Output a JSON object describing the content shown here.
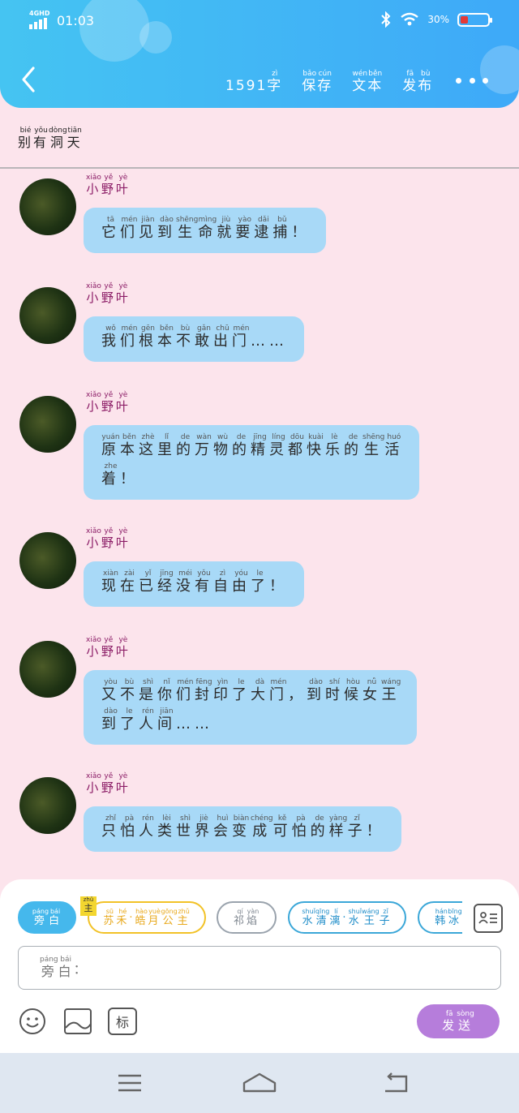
{
  "status_bar": {
    "network": "4GHD",
    "time": "01:03",
    "battery": "30%"
  },
  "header": {
    "word_count": "1591",
    "actions": [
      {
        "name": "word-count-unit",
        "text": "字",
        "pinyin": "zì"
      },
      {
        "name": "save-button",
        "chars": [
          {
            "c": "保",
            "p": "bǎo"
          },
          {
            "c": "存",
            "p": "cún"
          }
        ]
      },
      {
        "name": "text-button",
        "chars": [
          {
            "c": "文",
            "p": "wén"
          },
          {
            "c": "本",
            "p": "běn"
          }
        ]
      },
      {
        "name": "publish-button",
        "chars": [
          {
            "c": "发",
            "p": "fā"
          },
          {
            "c": "布",
            "p": "bù"
          }
        ]
      }
    ]
  },
  "document_title": [
    {
      "c": "别",
      "p": "bié"
    },
    {
      "c": "有",
      "p": "yǒu"
    },
    {
      "c": "洞",
      "p": "dòng"
    },
    {
      "c": "天",
      "p": "tiān"
    }
  ],
  "speaker_name": [
    {
      "c": "小",
      "p": "xiǎo"
    },
    {
      "c": "野",
      "p": "yě"
    },
    {
      "c": "叶",
      "p": "yè"
    }
  ],
  "messages": [
    {
      "lines": [
        [
          {
            "c": "它",
            "p": "tā"
          },
          {
            "c": "们",
            "p": "mén"
          },
          {
            "c": "见",
            "p": "jiàn"
          },
          {
            "c": "到",
            "p": "dào"
          },
          {
            "c": "生",
            "p": "shēng"
          },
          {
            "c": "命",
            "p": "mìng"
          },
          {
            "c": "就",
            "p": "jiù"
          },
          {
            "c": "要",
            "p": "yào"
          },
          {
            "c": "逮",
            "p": "dǎi"
          },
          {
            "c": "捕",
            "p": "bǔ"
          },
          {
            "c": "！",
            "p": ""
          }
        ]
      ]
    },
    {
      "lines": [
        [
          {
            "c": "我",
            "p": "wǒ"
          },
          {
            "c": "们",
            "p": "mén"
          },
          {
            "c": "根",
            "p": "gēn"
          },
          {
            "c": "本",
            "p": "běn"
          },
          {
            "c": "不",
            "p": "bù"
          },
          {
            "c": "敢",
            "p": "gǎn"
          },
          {
            "c": "出",
            "p": "chū"
          },
          {
            "c": "门",
            "p": "mén"
          },
          {
            "c": "……",
            "p": ""
          }
        ]
      ]
    },
    {
      "lines": [
        [
          {
            "c": "原",
            "p": "yuán"
          },
          {
            "c": "本",
            "p": "běn"
          },
          {
            "c": "这",
            "p": "zhè"
          },
          {
            "c": "里",
            "p": "lǐ"
          },
          {
            "c": "的",
            "p": "de"
          },
          {
            "c": "万",
            "p": "wàn"
          },
          {
            "c": "物",
            "p": "wù"
          },
          {
            "c": "的",
            "p": "de"
          },
          {
            "c": "精",
            "p": "jīng"
          },
          {
            "c": "灵",
            "p": "líng"
          },
          {
            "c": "都",
            "p": "dōu"
          },
          {
            "c": "快",
            "p": "kuài"
          },
          {
            "c": "乐",
            "p": "lè"
          },
          {
            "c": "的",
            "p": "de"
          },
          {
            "c": "生",
            "p": "shēng"
          },
          {
            "c": "活",
            "p": "huó"
          }
        ],
        [
          {
            "c": "着",
            "p": "zhe"
          },
          {
            "c": "！",
            "p": ""
          }
        ]
      ]
    },
    {
      "lines": [
        [
          {
            "c": "现",
            "p": "xiàn"
          },
          {
            "c": "在",
            "p": "zài"
          },
          {
            "c": "已",
            "p": "yǐ"
          },
          {
            "c": "经",
            "p": "jīng"
          },
          {
            "c": "没",
            "p": "méi"
          },
          {
            "c": "有",
            "p": "yǒu"
          },
          {
            "c": "自",
            "p": "zì"
          },
          {
            "c": "由",
            "p": "yóu"
          },
          {
            "c": "了",
            "p": "le"
          },
          {
            "c": "！",
            "p": ""
          }
        ]
      ]
    },
    {
      "lines": [
        [
          {
            "c": "又",
            "p": "yòu"
          },
          {
            "c": "不",
            "p": "bù"
          },
          {
            "c": "是",
            "p": "shì"
          },
          {
            "c": "你",
            "p": "nǐ"
          },
          {
            "c": "们",
            "p": "mén"
          },
          {
            "c": "封",
            "p": "fēng"
          },
          {
            "c": "印",
            "p": "yìn"
          },
          {
            "c": "了",
            "p": "le"
          },
          {
            "c": "大",
            "p": "dà"
          },
          {
            "c": "门",
            "p": "mén"
          },
          {
            "c": "，",
            "p": ""
          },
          {
            "c": "到",
            "p": "dào"
          },
          {
            "c": "时",
            "p": "shí"
          },
          {
            "c": "候",
            "p": "hòu"
          },
          {
            "c": "女",
            "p": "nǚ"
          },
          {
            "c": "王",
            "p": "wáng"
          }
        ],
        [
          {
            "c": "到",
            "p": "dào"
          },
          {
            "c": "了",
            "p": "le"
          },
          {
            "c": "人",
            "p": "rén"
          },
          {
            "c": "间",
            "p": "jiān"
          },
          {
            "c": "……",
            "p": ""
          }
        ]
      ]
    },
    {
      "lines": [
        [
          {
            "c": "只",
            "p": "zhǐ"
          },
          {
            "c": "怕",
            "p": "pà"
          },
          {
            "c": "人",
            "p": "rén"
          },
          {
            "c": "类",
            "p": "lèi"
          },
          {
            "c": "世",
            "p": "shì"
          },
          {
            "c": "界",
            "p": "jiè"
          },
          {
            "c": "会",
            "p": "huì"
          },
          {
            "c": "变",
            "p": "biàn"
          },
          {
            "c": "成",
            "p": "chéng"
          },
          {
            "c": "可",
            "p": "kě"
          },
          {
            "c": "怕",
            "p": "pà"
          },
          {
            "c": "的",
            "p": "de"
          },
          {
            "c": "样",
            "p": "yàng"
          },
          {
            "c": "子",
            "p": "zǐ"
          },
          {
            "c": "！",
            "p": ""
          }
        ]
      ]
    }
  ],
  "role_chips": [
    {
      "name": "role-chip-narrator",
      "style": "active",
      "chars": [
        {
          "c": "旁",
          "p": "páng"
        },
        {
          "c": "白",
          "p": "bái"
        }
      ]
    },
    {
      "name": "role-chip-princess",
      "style": "gold",
      "chars": [
        {
          "c": "苏",
          "p": "sū"
        },
        {
          "c": "禾",
          "p": "hé"
        },
        {
          "c": "·",
          "p": ""
        },
        {
          "c": "皓",
          "p": "hào"
        },
        {
          "c": "月",
          "p": "yuè"
        },
        {
          "c": "公",
          "p": "gōng"
        },
        {
          "c": "主",
          "p": "zhǔ"
        }
      ]
    },
    {
      "name": "role-chip-qiyan",
      "style": "gray",
      "chars": [
        {
          "c": "祁",
          "p": "qí"
        },
        {
          "c": "焰",
          "p": "yàn"
        }
      ]
    },
    {
      "name": "role-chip-water-queen",
      "style": "blue",
      "chars": [
        {
          "c": "水",
          "p": "shuǐ"
        },
        {
          "c": "清",
          "p": "qīng"
        },
        {
          "c": "漓",
          "p": "lí"
        },
        {
          "c": "·",
          "p": ""
        },
        {
          "c": "水",
          "p": "shuǐ"
        },
        {
          "c": "王",
          "p": "wáng"
        },
        {
          "c": "子",
          "p": "zǐ"
        }
      ]
    },
    {
      "name": "role-chip-hanbing",
      "style": "blue",
      "chars": [
        {
          "c": "韩",
          "p": "hán"
        },
        {
          "c": "冰",
          "p": "bīng"
        }
      ]
    }
  ],
  "main_role_tag": {
    "text": "主",
    "pinyin": "zhǔ"
  },
  "input": {
    "prefix": [
      {
        "c": "旁",
        "p": "páng"
      },
      {
        "c": "白",
        "p": "bái"
      }
    ],
    "colon": "："
  },
  "tag_button": "标",
  "send_button": [
    {
      "c": "发",
      "p": "fā"
    },
    {
      "c": "送",
      "p": "sòng"
    }
  ],
  "colors": {
    "header_start": "#45c4f2",
    "header_end": "#3ea9f8",
    "background": "#fce4ec",
    "bubble": "#a8d9f7",
    "speaker": "#8b1c66",
    "send": "#b67ddb",
    "chip_active": "#45b8ec"
  }
}
